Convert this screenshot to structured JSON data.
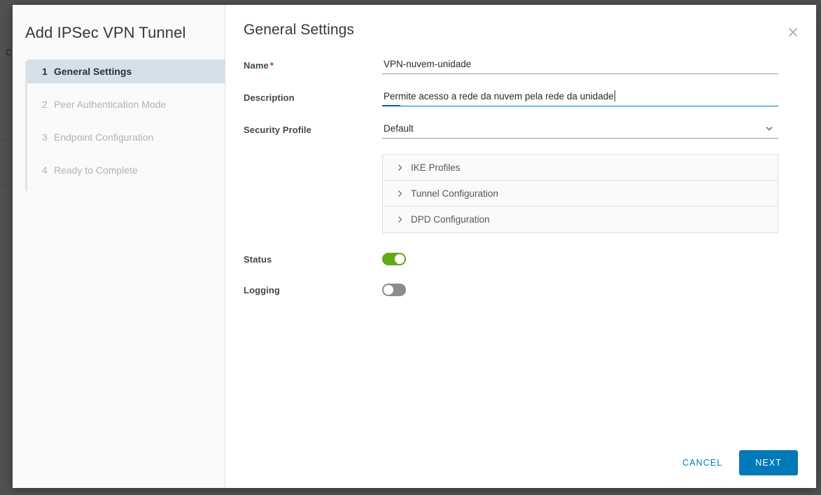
{
  "backdrop": {
    "hint_text": "C"
  },
  "wizard": {
    "title": "Add IPSec VPN Tunnel",
    "steps": [
      {
        "num": "1",
        "label": "General Settings",
        "active": true
      },
      {
        "num": "2",
        "label": "Peer Authentication Mode",
        "active": false
      },
      {
        "num": "3",
        "label": "Endpoint Configuration",
        "active": false
      },
      {
        "num": "4",
        "label": "Ready to Complete",
        "active": false
      }
    ]
  },
  "pane": {
    "title": "General Settings",
    "close_icon": "close-icon"
  },
  "form": {
    "name": {
      "label": "Name",
      "required_marker": "*",
      "value": "VPN-nuvem-unidade",
      "placeholder": ""
    },
    "description": {
      "label": "Description",
      "value": "Permite acesso a rede da nuvem pela rede da unidade",
      "placeholder": "",
      "focused": true
    },
    "security_profile": {
      "label": "Security Profile",
      "value": "Default",
      "options": [
        "Default"
      ],
      "chevron_icon": "chevron-down-icon"
    }
  },
  "accordion": {
    "items": [
      {
        "label": "IKE Profiles",
        "icon": "chevron-right-icon",
        "expanded": false
      },
      {
        "label": "Tunnel Configuration",
        "icon": "chevron-right-icon",
        "expanded": false
      },
      {
        "label": "DPD Configuration",
        "icon": "chevron-right-icon",
        "expanded": false
      }
    ]
  },
  "toggles": [
    {
      "label": "Status",
      "state": "on",
      "color": "#60a917"
    },
    {
      "label": "Logging",
      "state": "off",
      "color": "#8c8c8c"
    }
  ],
  "footer": {
    "cancel_label": "CANCEL",
    "next_label": "NEXT",
    "accent_color": "#0079b8"
  }
}
